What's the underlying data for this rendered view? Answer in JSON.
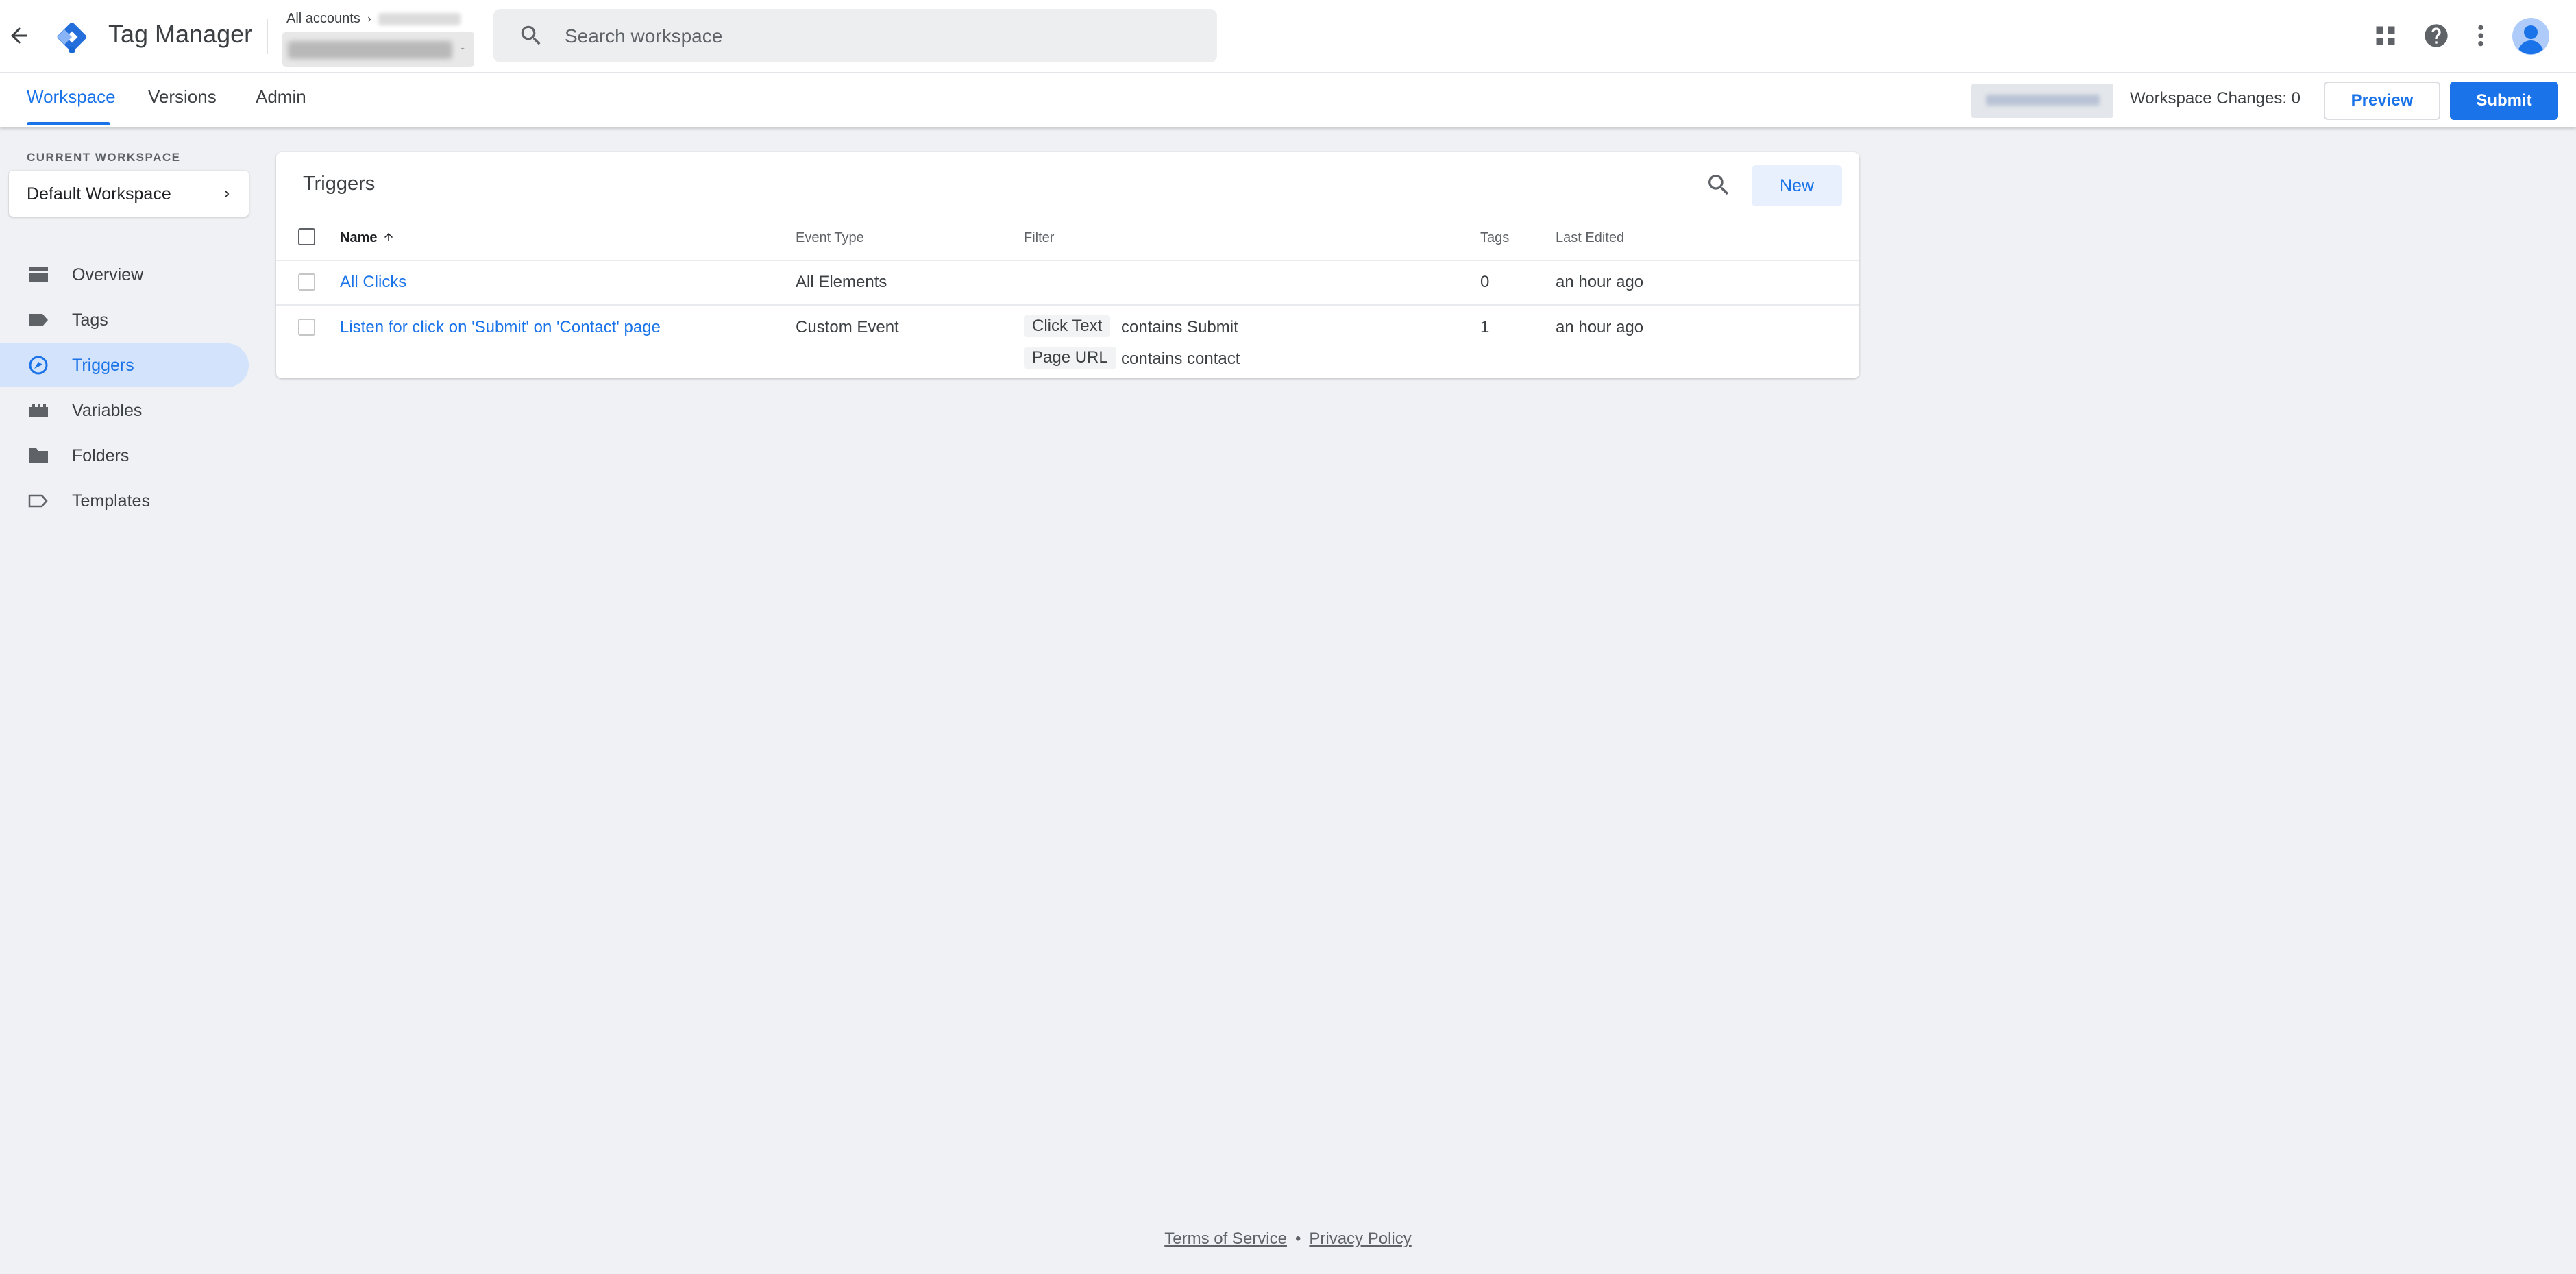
{
  "header": {
    "app_title": "Tag Manager",
    "breadcrumb_root": "All accounts",
    "search_placeholder": "Search workspace",
    "icons": [
      "arrow-back-icon",
      "gtm-logo",
      "search-icon",
      "apps-grid-icon",
      "help-icon",
      "more-vert-icon",
      "account-avatar"
    ]
  },
  "tabs": [
    {
      "label": "Workspace",
      "active": true
    },
    {
      "label": "Versions",
      "active": false
    },
    {
      "label": "Admin",
      "active": false
    }
  ],
  "toolbar": {
    "workspace_changes": "Workspace Changes: 0",
    "preview_label": "Preview",
    "submit_label": "Submit"
  },
  "sidebar": {
    "current_workspace_label": "CURRENT WORKSPACE",
    "workspace_name": "Default Workspace",
    "items": [
      {
        "label": "Overview",
        "icon": "overview-icon",
        "active": false
      },
      {
        "label": "Tags",
        "icon": "tag-icon",
        "active": false
      },
      {
        "label": "Triggers",
        "icon": "trigger-icon",
        "active": true
      },
      {
        "label": "Variables",
        "icon": "variables-icon",
        "active": false
      },
      {
        "label": "Folders",
        "icon": "folder-icon",
        "active": false
      },
      {
        "label": "Templates",
        "icon": "template-icon",
        "active": false
      }
    ]
  },
  "triggers": {
    "title": "Triggers",
    "new_label": "New",
    "columns": {
      "name": "Name",
      "event_type": "Event Type",
      "filter": "Filter",
      "tags": "Tags",
      "last_edited": "Last Edited"
    },
    "rows": [
      {
        "name": "All Clicks",
        "event_type": "All Elements",
        "filters": [],
        "tags": "0",
        "last_edited": "an hour ago"
      },
      {
        "name": "Listen for click on 'Submit' on 'Contact' page",
        "event_type": "Custom Event",
        "filters": [
          {
            "variable": "Click Text",
            "condition": "contains Submit"
          },
          {
            "variable": "Page URL",
            "condition": "contains contact"
          }
        ],
        "tags": "1",
        "last_edited": "an hour ago"
      }
    ]
  },
  "footer": {
    "terms": "Terms of Service",
    "separator": "•",
    "privacy": "Privacy Policy"
  },
  "colors": {
    "accent": "#1a73e8",
    "background": "#eff1f4",
    "active_nav": "#d3e3fb",
    "logo_dark": "#246fdb",
    "logo_light": "#8ab4f8"
  }
}
